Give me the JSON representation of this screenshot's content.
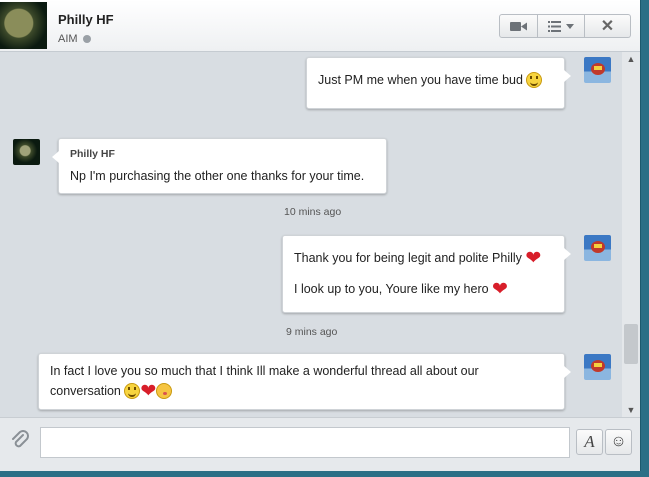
{
  "header": {
    "contact_name": "Philly HF",
    "service": "AIM",
    "buttons": {
      "video_icon": "video-camera-icon",
      "menu_icon": "list-icon",
      "close_icon": "close-icon",
      "close_glyph": "✕"
    }
  },
  "messages": [
    {
      "side": "right",
      "text": "Just PM me when you have time bud",
      "emoji": "smile"
    },
    {
      "side": "left",
      "sender": "Philly HF",
      "text": "Np I'm purchasing the other one thanks for your time."
    },
    {
      "timestamp": "10 mins ago"
    },
    {
      "side": "right",
      "line1": "Thank you for being legit and polite Philly",
      "line2": "I look up to you, Youre like my hero"
    },
    {
      "timestamp": "9 mins ago"
    },
    {
      "side": "right",
      "line1": "In fact I love you so much that I think Ill make a wonderful thread all about our",
      "line2": "conversation"
    }
  ],
  "composer": {
    "placeholder": "",
    "value": "",
    "format_label": "A",
    "emoji_glyph": "☺",
    "attach_glyph": "📎"
  },
  "scrollbar": {
    "up": "▲",
    "down": "▼"
  },
  "emoji": {
    "heart": "❤"
  }
}
